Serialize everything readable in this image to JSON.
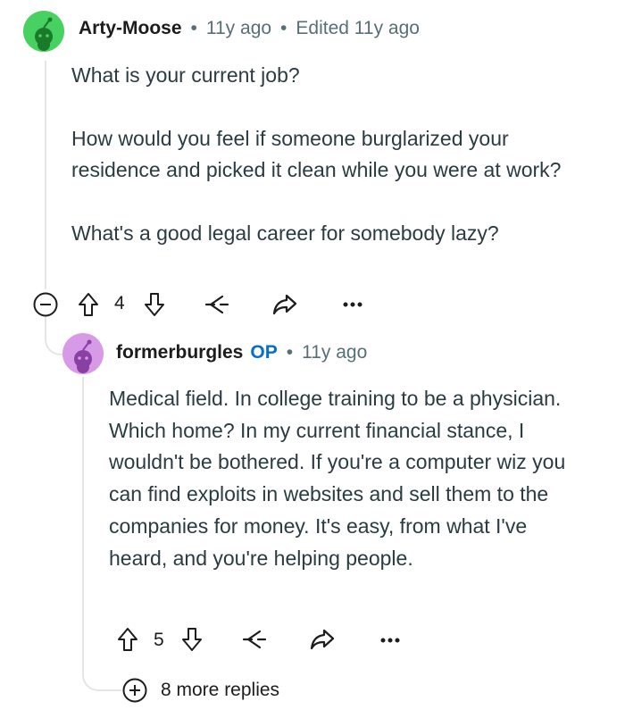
{
  "comment": {
    "username": "Arty-Moose",
    "posted": "11y ago",
    "edited": "Edited 11y ago",
    "avatar_color": "#46d160",
    "paragraphs": [
      "What is your current job?",
      "How would you feel if someone burglarized your residence and picked it clean while you were at work?",
      "What's a good legal career for somebody lazy?"
    ],
    "score": "4",
    "icons": [
      "collapse-icon",
      "upvote-icon",
      "downvote-icon",
      "award-icon",
      "share-icon",
      "more-icon"
    ]
  },
  "reply": {
    "username": "formerburgles",
    "op_badge": "OP",
    "posted": "11y ago",
    "avatar_color": "#d69ae6",
    "paragraphs": [
      "Medical field. In college training to be a physician. Which home? In my current financial stance, I wouldn't be bothered. If you're a computer wiz you can find exploits in websites and sell them to the companies for money. It's easy, from what I've heard, and you're helping people."
    ],
    "score": "5",
    "more_replies": "8 more replies"
  },
  "separator": "•",
  "colors": {
    "meta": "#576f76",
    "op": "#0a6ec9",
    "thread_line": "#e3e6e8"
  }
}
